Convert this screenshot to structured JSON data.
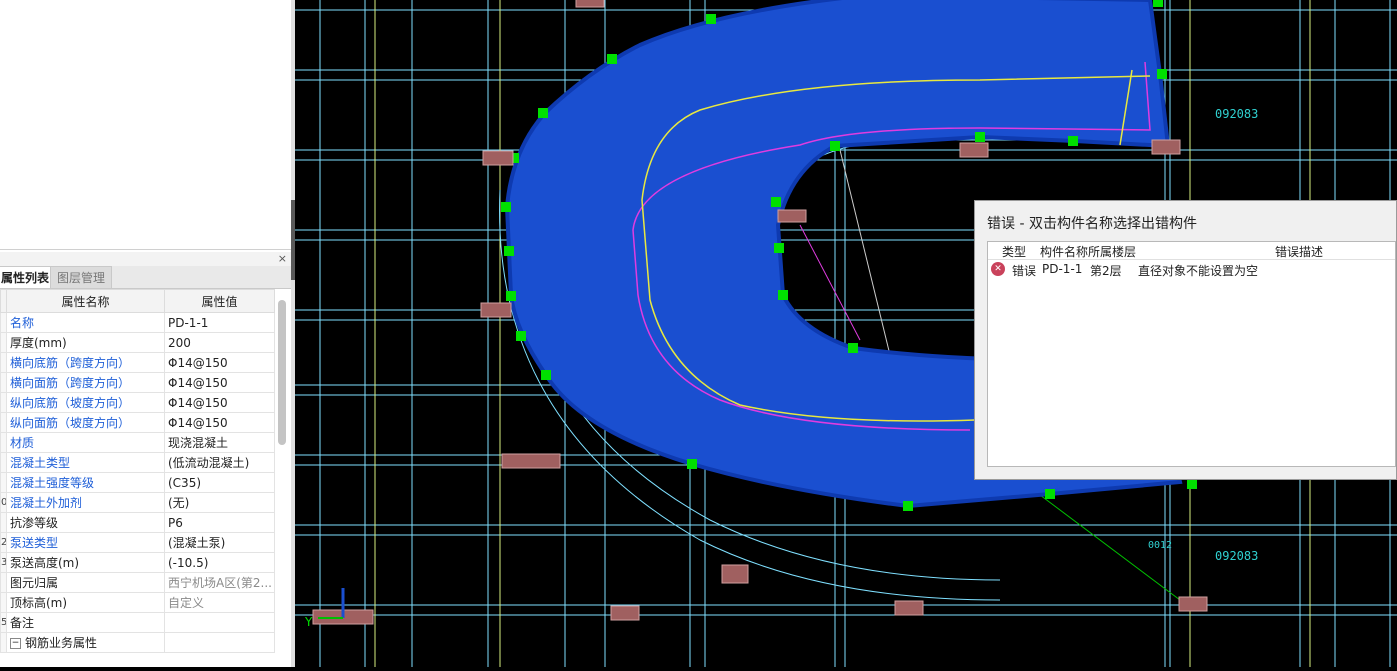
{
  "panel": {
    "close_glyph": "×",
    "tabs": [
      "属性列表",
      "图层管理"
    ],
    "table_headers": {
      "name": "属性名称",
      "value": "属性值"
    },
    "rows": [
      {
        "num": "",
        "name": "名称",
        "value": "PD-1-1",
        "name_style": "blue",
        "value_style": "val"
      },
      {
        "num": "",
        "name": "厚度(mm)",
        "value": "200",
        "name_style": "dark",
        "value_style": "val"
      },
      {
        "num": "",
        "name": "横向底筋（跨度方向）",
        "value": "Φ14@150",
        "name_style": "blue",
        "value_style": "val"
      },
      {
        "num": "",
        "name": "横向面筋（跨度方向）",
        "value": "Φ14@150",
        "name_style": "blue",
        "value_style": "val"
      },
      {
        "num": "",
        "name": "纵向底筋（坡度方向）",
        "value": "Φ14@150",
        "name_style": "blue",
        "value_style": "val"
      },
      {
        "num": "",
        "name": "纵向面筋（坡度方向）",
        "value": "Φ14@150",
        "name_style": "blue",
        "value_style": "val"
      },
      {
        "num": "",
        "name": "材质",
        "value": "现浇混凝土",
        "name_style": "blue",
        "value_style": "val"
      },
      {
        "num": "",
        "name": "混凝土类型",
        "value": "(低流动混凝土)",
        "name_style": "blue",
        "value_style": "val"
      },
      {
        "num": "",
        "name": "混凝土强度等级",
        "value": "(C35)",
        "name_style": "blue",
        "value_style": "val"
      },
      {
        "num": "0",
        "name": "混凝土外加剂",
        "value": "(无)",
        "name_style": "blue",
        "value_style": "val"
      },
      {
        "num": "",
        "name": "抗渗等级",
        "value": "P6",
        "name_style": "dark",
        "value_style": "val"
      },
      {
        "num": "2",
        "name": "泵送类型",
        "value": "(混凝土泵)",
        "name_style": "blue",
        "value_style": "val"
      },
      {
        "num": "3",
        "name": "泵送高度(m)",
        "value": "(-10.5)",
        "name_style": "dark",
        "value_style": "val"
      },
      {
        "num": "",
        "name": "图元归属",
        "value": "西宁机场A区(第2...",
        "name_style": "dark",
        "value_style": "gray"
      },
      {
        "num": "",
        "name": "顶标高(m)",
        "value": "自定义",
        "name_style": "dark",
        "value_style": "gray"
      },
      {
        "num": "5",
        "name": "备注",
        "value": "",
        "name_style": "dark",
        "value_style": "val"
      },
      {
        "num": "",
        "name": "钢筋业务属性",
        "value": "",
        "name_style": "dark",
        "value_style": "val",
        "expander": "−"
      }
    ]
  },
  "viewport": {
    "ramp_color": "#1a4fd0",
    "ramp_edge_color": "#0e3ab0",
    "grip_color": "#00e000",
    "grid_color": "#7fe0ff",
    "inner_grid_color": "#d8f080",
    "axis_label": "Y",
    "dimension_texts": [
      "092083",
      "092083",
      "0012"
    ]
  },
  "error_dialog": {
    "title": "错误 - 双击构件名称选择出错构件",
    "columns": [
      "类型",
      "构件名称",
      "所属楼层",
      "错误描述"
    ],
    "row": {
      "type": "错误",
      "name": "PD-1-1",
      "floor": "第2层",
      "description": "直径对象不能设置为空"
    },
    "icon": "error-icon"
  }
}
